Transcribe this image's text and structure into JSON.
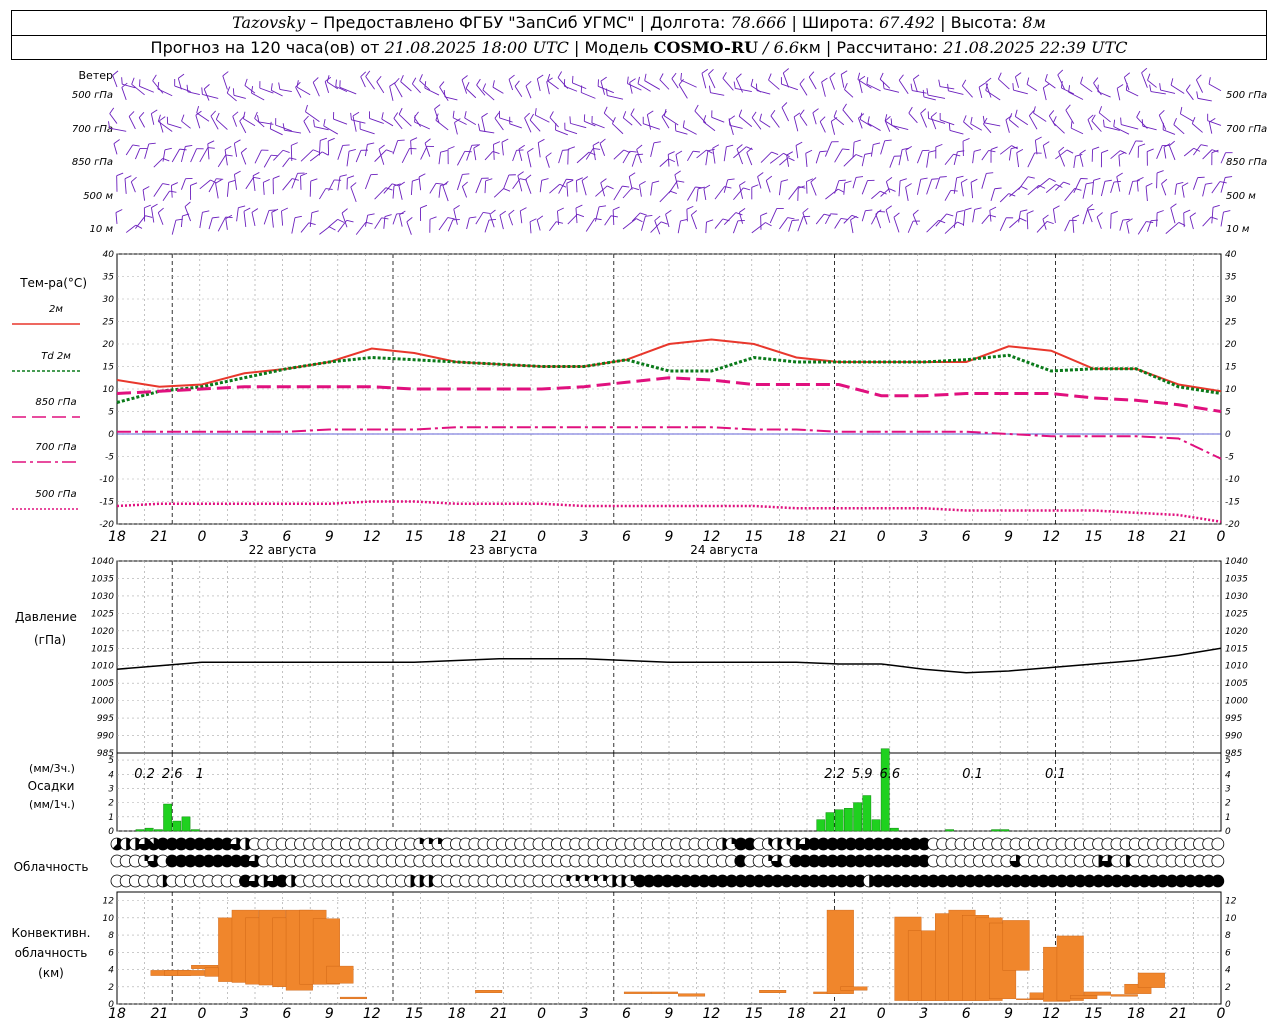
{
  "header": {
    "station": "Tazovsky",
    "provider_label": "– Предоставлено ФГБУ \"ЗапСиб УГМС\" |",
    "lon_label": "Долгота:",
    "lon": "78.666",
    "lat_label": "| Широта:",
    "lat": "67.492",
    "alt_label": "| Высота:",
    "alt": "8м",
    "forecast_label": "Прогноз на 120 часа(ов) от",
    "forecast_start": "21.08.2025 18:00 UTC",
    "model_label": "| Модель",
    "model": "COSMO-RU",
    "model_res": "/ 6.6",
    "model_res_unit": "км",
    "computed_label": "| Рассчитано:",
    "computed": "21.08.2025 22:39 UTC"
  },
  "panels": {
    "wind": {
      "title": "Ветер",
      "levels": [
        "500 гПа",
        "700 гПа",
        "850 гПа",
        "500 м",
        "10  м"
      ]
    },
    "temperature": {
      "title": "Тем-ра(°С)",
      "legend": [
        {
          "label": "2м",
          "color": "#e8372c",
          "style": "solid"
        },
        {
          "label": "Td  2м",
          "color": "#0a7a1a",
          "style": "dotted"
        },
        {
          "label": "850 гПа",
          "color": "#e0107e",
          "style": "dashed"
        },
        {
          "label": "700 гПа",
          "color": "#e0107e",
          "style": "dashdot"
        },
        {
          "label": "500 гПа",
          "color": "#e0107e",
          "style": "fine-dotted"
        }
      ],
      "ticks": [
        "40",
        "35",
        "30",
        "25",
        "20",
        "15",
        "10",
        "5",
        "0",
        "-5",
        "-10",
        "-15",
        "-20"
      ]
    },
    "pressure": {
      "title_line1": "Давление",
      "title_line2": "(гПа)",
      "ticks": [
        "1040",
        "1035",
        "1030",
        "1025",
        "1020",
        "1015",
        "1010",
        "1005",
        "1000",
        "995",
        "990",
        "985"
      ]
    },
    "precip": {
      "unit_top": "(мм/3ч.)",
      "title": "Осадки",
      "unit_bottom": "(мм/1ч.)",
      "ticks": [
        "5",
        "4",
        "3",
        "2",
        "1",
        "0"
      ],
      "totals": [
        {
          "hour": 3,
          "text": "0.2"
        },
        {
          "hour": 6,
          "text": "2.6"
        },
        {
          "hour": 9,
          "text": "1"
        },
        {
          "hour": 78,
          "text": "2.2"
        },
        {
          "hour": 81,
          "text": "5.9"
        },
        {
          "hour": 84,
          "text": "6.6"
        },
        {
          "hour": 93,
          "text": "0.1"
        },
        {
          "hour": 102,
          "text": "0.1"
        }
      ]
    },
    "clouds": {
      "title": "Облачность"
    },
    "convective": {
      "title_line1": "Конвективн.",
      "title_line2": "облачность",
      "title_line3": "(км)",
      "ticks": [
        "12",
        "10",
        "8",
        "6",
        "4",
        "2",
        "0"
      ]
    }
  },
  "time_axis": {
    "hour_labels": [
      "18",
      "21",
      "0",
      "3",
      "6",
      "9",
      "12",
      "15",
      "18",
      "21",
      "0",
      "3",
      "6",
      "9",
      "12",
      "15",
      "18",
      "21",
      "0",
      "3",
      "6",
      "9",
      "12",
      "15",
      "18",
      "21",
      "0"
    ],
    "date_labels": [
      {
        "hour": 18,
        "text": "22 августа"
      },
      {
        "hour": 42,
        "text": "23 августа"
      },
      {
        "hour": 66,
        "text": "24 августа"
      }
    ]
  },
  "chart_data": {
    "type": "line",
    "x_unit": "hours from 21.08.2025 18:00 UTC",
    "temperature": {
      "ylim": [
        -20,
        40
      ],
      "series": [
        {
          "name": "2м",
          "color": "#e8372c",
          "x": [
            0,
            3,
            6,
            9,
            12,
            15,
            18,
            21,
            24,
            27,
            30,
            33,
            36,
            39,
            42,
            45,
            48,
            51,
            54,
            57,
            60,
            63,
            66,
            69,
            72,
            75,
            78
          ],
          "y": [
            12,
            10.5,
            11,
            13.5,
            14.5,
            16,
            19,
            18,
            16,
            15.5,
            15,
            15,
            16.5,
            20,
            21,
            20,
            17,
            16,
            16,
            16,
            16,
            19.5,
            18.5,
            14.5,
            14.5,
            11,
            9.5
          ]
        },
        {
          "name": "Td  2м",
          "color": "#0a7a1a",
          "x": [
            0,
            3,
            6,
            9,
            12,
            15,
            18,
            21,
            24,
            27,
            30,
            33,
            36,
            39,
            42,
            45,
            48,
            51,
            54,
            57,
            60,
            63,
            66,
            69,
            72,
            75,
            78
          ],
          "y": [
            7,
            9.5,
            10.5,
            12.5,
            14.5,
            16,
            17,
            16.5,
            16,
            15.5,
            15,
            15,
            16.5,
            14,
            14,
            17,
            16,
            16,
            16,
            16,
            16.5,
            17.5,
            14,
            14.5,
            14.5,
            10.5,
            9
          ]
        },
        {
          "name": "850 гПа",
          "color": "#e0107e",
          "x": [
            0,
            3,
            6,
            9,
            12,
            15,
            18,
            21,
            24,
            27,
            30,
            33,
            36,
            39,
            42,
            45,
            48,
            51,
            54,
            57,
            60,
            63,
            66,
            69,
            72,
            75,
            78
          ],
          "y": [
            9,
            9.5,
            10,
            10.5,
            10.5,
            10.5,
            10.5,
            10,
            10,
            10,
            10,
            10.5,
            11.5,
            12.5,
            12,
            11,
            11,
            11,
            8.5,
            8.5,
            9,
            9,
            9,
            8,
            7.5,
            6.5,
            5
          ]
        },
        {
          "name": "700 гПа",
          "color": "#e0107e",
          "x": [
            0,
            3,
            6,
            9,
            12,
            15,
            18,
            21,
            24,
            27,
            30,
            33,
            36,
            39,
            42,
            45,
            48,
            51,
            54,
            57,
            60,
            63,
            66,
            69,
            72,
            75,
            78
          ],
          "y": [
            0.5,
            0.5,
            0.5,
            0.5,
            0.5,
            1,
            1,
            1,
            1.5,
            1.5,
            1.5,
            1.5,
            1.5,
            1.5,
            1.5,
            1,
            1,
            0.5,
            0.5,
            0.5,
            0.5,
            0,
            -0.5,
            -0.5,
            -0.5,
            -1,
            -5.5
          ]
        },
        {
          "name": "500 гПа",
          "color": "#e0107e",
          "x": [
            0,
            3,
            6,
            9,
            12,
            15,
            18,
            21,
            24,
            27,
            30,
            33,
            36,
            39,
            42,
            45,
            48,
            51,
            54,
            57,
            60,
            63,
            66,
            69,
            72,
            75,
            78
          ],
          "y": [
            -16,
            -15.5,
            -15.5,
            -15.5,
            -15.5,
            -15.5,
            -15,
            -15,
            -15.5,
            -15.5,
            -15.5,
            -16,
            -16,
            -16,
            -16,
            -16,
            -16.5,
            -16.5,
            -16.5,
            -16.5,
            -17,
            -17,
            -17,
            -17,
            -17.5,
            -18,
            -19.5
          ]
        }
      ]
    },
    "pressure": {
      "ylim": [
        985,
        1040
      ],
      "x": [
        0,
        3,
        6,
        9,
        12,
        15,
        18,
        21,
        24,
        27,
        30,
        33,
        36,
        39,
        42,
        45,
        48,
        51,
        54,
        57,
        60,
        63,
        66,
        69,
        72,
        75,
        78
      ],
      "y": [
        1009,
        1010,
        1011,
        1011,
        1011,
        1011,
        1011,
        1011,
        1011.5,
        1012,
        1012,
        1012,
        1011.5,
        1011,
        1011,
        1011,
        1011,
        1010.5,
        1010.5,
        1009,
        1008,
        1008.5,
        1009.5,
        1010.5,
        1011.5,
        1013,
        1015
      ]
    },
    "precip": {
      "ylim": [
        0,
        5.5
      ],
      "bars": [
        {
          "x": 2,
          "mm": 0.1
        },
        {
          "x": 3,
          "mm": 0.2
        },
        {
          "x": 4,
          "mm": 0.1
        },
        {
          "x": 5,
          "mm": 1.9
        },
        {
          "x": 6,
          "mm": 0.7
        },
        {
          "x": 7,
          "mm": 1
        },
        {
          "x": 8,
          "mm": 0.1
        },
        {
          "x": 76,
          "mm": 0.8
        },
        {
          "x": 77,
          "mm": 1.3
        },
        {
          "x": 78,
          "mm": 1.5
        },
        {
          "x": 79,
          "mm": 1.6
        },
        {
          "x": 80,
          "mm": 2.0
        },
        {
          "x": 81,
          "mm": 2.5
        },
        {
          "x": 82,
          "mm": 0.8
        },
        {
          "x": 83,
          "mm": 5.8
        },
        {
          "x": 84,
          "mm": 0.2
        },
        {
          "x": 90,
          "mm": 0.1
        },
        {
          "x": 95,
          "mm": 0.1
        },
        {
          "x": 96,
          "mm": 0.1
        }
      ]
    },
    "clouds": {
      "rows": 3,
      "note": "cloud amount in eighths (0..8) per hour for low / mid / high layers",
      "low": [
        5,
        4,
        4,
        6,
        7,
        8,
        8,
        8,
        8,
        8,
        8,
        8,
        8,
        6,
        4,
        0,
        0,
        0,
        0,
        0,
        0,
        0,
        0,
        0,
        0,
        0,
        0,
        0,
        0,
        0,
        0,
        0,
        0,
        2,
        2,
        2,
        0,
        0,
        0,
        0,
        0,
        0,
        0,
        0,
        0,
        0,
        0,
        0,
        0,
        0,
        0,
        0,
        0,
        0,
        0,
        0,
        0,
        0,
        0,
        0,
        0,
        0,
        0,
        0,
        0,
        0,
        4,
        2,
        8,
        8,
        0,
        3,
        4,
        3,
        4,
        6,
        8,
        8,
        8,
        8,
        8,
        8,
        8,
        8,
        8,
        8,
        8,
        8,
        8,
        0,
        0,
        0,
        0,
        0,
        0,
        0,
        0,
        0,
        0,
        0,
        0,
        0,
        0,
        0,
        0,
        0,
        0,
        0,
        0,
        0,
        0,
        0,
        0,
        0,
        0,
        0,
        0,
        0,
        0,
        0,
        0
      ],
      "mid": [
        0,
        0,
        0,
        2,
        6,
        0,
        8,
        8,
        8,
        8,
        8,
        8,
        8,
        8,
        8,
        6,
        0,
        0,
        0,
        0,
        0,
        0,
        0,
        0,
        0,
        0,
        0,
        0,
        0,
        0,
        0,
        0,
        0,
        0,
        0,
        0,
        0,
        0,
        0,
        0,
        0,
        0,
        0,
        0,
        0,
        0,
        0,
        0,
        0,
        0,
        0,
        0,
        0,
        0,
        0,
        0,
        0,
        0,
        0,
        0,
        0,
        0,
        0,
        0,
        0,
        0,
        0,
        0,
        8,
        0,
        0,
        2,
        6,
        0,
        8,
        8,
        8,
        8,
        8,
        8,
        8,
        8,
        8,
        8,
        8,
        8,
        8,
        8,
        8,
        0,
        0,
        0,
        0,
        0,
        0,
        0,
        0,
        0,
        6,
        0,
        0,
        0,
        0,
        0,
        0,
        0,
        0,
        4,
        6,
        0,
        4,
        0,
        0,
        0,
        0,
        0,
        0,
        0,
        0,
        0,
        0
      ],
      "high": [
        0,
        0,
        0,
        0,
        0,
        4,
        0,
        0,
        0,
        0,
        0,
        0,
        0,
        0,
        8,
        6,
        4,
        6,
        8,
        4,
        0,
        0,
        0,
        0,
        0,
        0,
        0,
        0,
        0,
        0,
        0,
        0,
        4,
        4,
        4,
        0,
        0,
        0,
        0,
        0,
        0,
        0,
        0,
        0,
        0,
        0,
        0,
        0,
        0,
        2,
        2,
        2,
        2,
        2,
        4,
        4,
        2,
        8,
        8,
        8,
        8,
        8,
        8,
        8,
        8,
        8,
        8,
        8,
        8,
        8,
        8,
        8,
        8,
        8,
        8,
        8,
        8,
        8,
        8,
        8,
        8,
        8,
        4,
        8,
        8,
        8,
        8,
        8,
        8,
        8,
        8,
        8,
        8,
        8,
        8,
        8,
        8,
        8,
        8,
        8,
        8,
        8,
        8,
        8,
        8,
        8,
        8,
        8,
        8,
        8,
        8,
        8,
        8,
        8,
        8,
        8,
        8,
        8,
        8,
        8,
        8
      ]
    },
    "convective": {
      "ylim": [
        0,
        13
      ],
      "note": "base and top of convective cloud in km, per hour",
      "bars": [
        {
          "x": 1,
          "base": 3.3,
          "top": 3.9
        },
        {
          "x": 2,
          "base": 3.3,
          "top": 3.9
        },
        {
          "x": 3,
          "base": 3.3,
          "top": 3.9
        },
        {
          "x": 4,
          "base": 4.1,
          "top": 4.5
        },
        {
          "x": 5,
          "base": 3.2,
          "top": 4.2
        },
        {
          "x": 6,
          "base": 2.6,
          "top": 10
        },
        {
          "x": 7,
          "base": 2.5,
          "top": 10.9
        },
        {
          "x": 8,
          "base": 2.3,
          "top": 10
        },
        {
          "x": 9,
          "base": 2.2,
          "top": 10.9
        },
        {
          "x": 10,
          "base": 2.0,
          "top": 10
        },
        {
          "x": 11,
          "base": 1.6,
          "top": 10.9
        },
        {
          "x": 12,
          "base": 2.3,
          "top": 10.9
        },
        {
          "x": 13,
          "base": 2.3,
          "top": 9.9
        },
        {
          "x": 14,
          "base": 2.4,
          "top": 4.4
        },
        {
          "x": 15,
          "base": 0.6,
          "top": 0.8
        },
        {
          "x": 25,
          "base": 1.3,
          "top": 1.6
        },
        {
          "x": 36,
          "base": 1.2,
          "top": 1.4
        },
        {
          "x": 38,
          "base": 1.2,
          "top": 1.4
        },
        {
          "x": 40,
          "base": 0.9,
          "top": 1.2
        },
        {
          "x": 46,
          "base": 1.3,
          "top": 1.6
        },
        {
          "x": 50,
          "base": 1.2,
          "top": 1.4
        },
        {
          "x": 51,
          "base": 1.2,
          "top": 10.9
        },
        {
          "x": 52,
          "base": 1.6,
          "top": 2.0
        },
        {
          "x": 56,
          "base": 0.4,
          "top": 10.1
        },
        {
          "x": 57,
          "base": 0.4,
          "top": 8.5
        },
        {
          "x": 58,
          "base": 0.4,
          "top": 8.5
        },
        {
          "x": 59,
          "base": 0.4,
          "top": 10.5
        },
        {
          "x": 60,
          "base": 0.4,
          "top": 10.9
        },
        {
          "x": 61,
          "base": 0.4,
          "top": 10.3
        },
        {
          "x": 62,
          "base": 0.4,
          "top": 10.0
        },
        {
          "x": 63,
          "base": 0.6,
          "top": 9.4
        },
        {
          "x": 64,
          "base": 3.9,
          "top": 9.7
        },
        {
          "x": 65,
          "base": 0.5,
          "top": 0.6
        },
        {
          "x": 66,
          "base": 0.6,
          "top": 1.3
        },
        {
          "x": 67,
          "base": 0.3,
          "top": 6.6
        },
        {
          "x": 68,
          "base": 0.4,
          "top": 7.9
        },
        {
          "x": 69,
          "base": 0.6,
          "top": 1.0
        },
        {
          "x": 70,
          "base": 1.0,
          "top": 1.4
        },
        {
          "x": 72,
          "base": 0.9,
          "top": 1.1
        },
        {
          "x": 73,
          "base": 1.2,
          "top": 2.3
        },
        {
          "x": 74,
          "base": 1.9,
          "top": 3.6
        }
      ]
    }
  }
}
